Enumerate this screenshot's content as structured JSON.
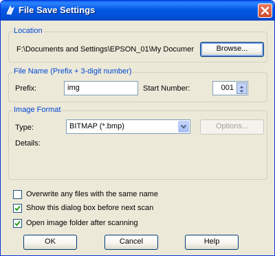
{
  "window": {
    "title": "File Save Settings"
  },
  "location": {
    "legend": "Location",
    "path": "F:\\Documents and Settings\\EPSON_01\\My Documer",
    "browse_label": "Browse..."
  },
  "file_name": {
    "legend": "File Name (Prefix + 3-digit number)",
    "prefix_label": "Prefix:",
    "prefix_value": "img",
    "start_number_label": "Start Number:",
    "start_number_value": "001"
  },
  "image_format": {
    "legend": "Image Format",
    "type_label": "Type:",
    "type_value": "BITMAP (*.bmp)",
    "options_label": "Options...",
    "details_label": "Details:"
  },
  "checkboxes": [
    {
      "label": "Overwrite any files with the same name",
      "checked": false
    },
    {
      "label": "Show this dialog box before next scan",
      "checked": true
    },
    {
      "label": "Open image folder after scanning",
      "checked": true
    }
  ],
  "buttons": {
    "ok": "OK",
    "cancel": "Cancel",
    "help": "Help"
  },
  "colors": {
    "title_bar": "#0458e4",
    "group_legend": "#0046d5",
    "dialog_bg": "#ece9d8"
  }
}
